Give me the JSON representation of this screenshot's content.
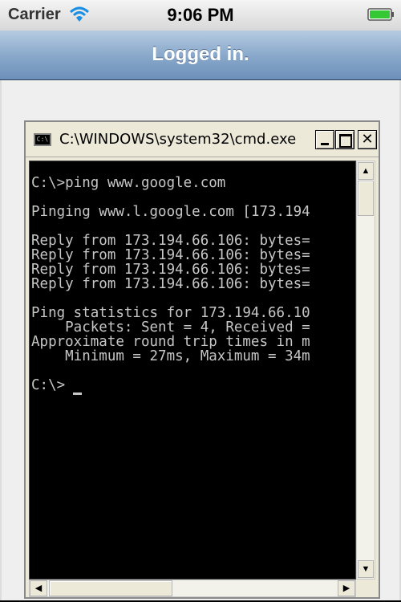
{
  "status_bar": {
    "carrier": "Carrier",
    "time": "9:06 PM",
    "wifi_icon": "wifi-icon",
    "battery_icon": "battery-icon",
    "battery_color": "#35c835"
  },
  "nav_bar": {
    "title": "Logged in."
  },
  "cmd_window": {
    "title": "C:\\WINDOWS\\system32\\cmd.exe",
    "app_icon_label": "C:\\",
    "buttons": {
      "minimize_label": "",
      "maximize_label": "",
      "close_label": "✕"
    },
    "console_lines": [
      "C:\\>ping www.google.com",
      "",
      "Pinging www.l.google.com [173.194",
      "",
      "Reply from 173.194.66.106: bytes=",
      "Reply from 173.194.66.106: bytes=",
      "Reply from 173.194.66.106: bytes=",
      "Reply from 173.194.66.106: bytes=",
      "",
      "Ping statistics for 173.194.66.10",
      "    Packets: Sent = 4, Received =",
      "Approximate round trip times in m",
      "    Minimum = 27ms, Maximum = 34m",
      "",
      "C:\\>"
    ],
    "console_text_color": "#c6c6c6",
    "console_bg_color": "#000000"
  }
}
